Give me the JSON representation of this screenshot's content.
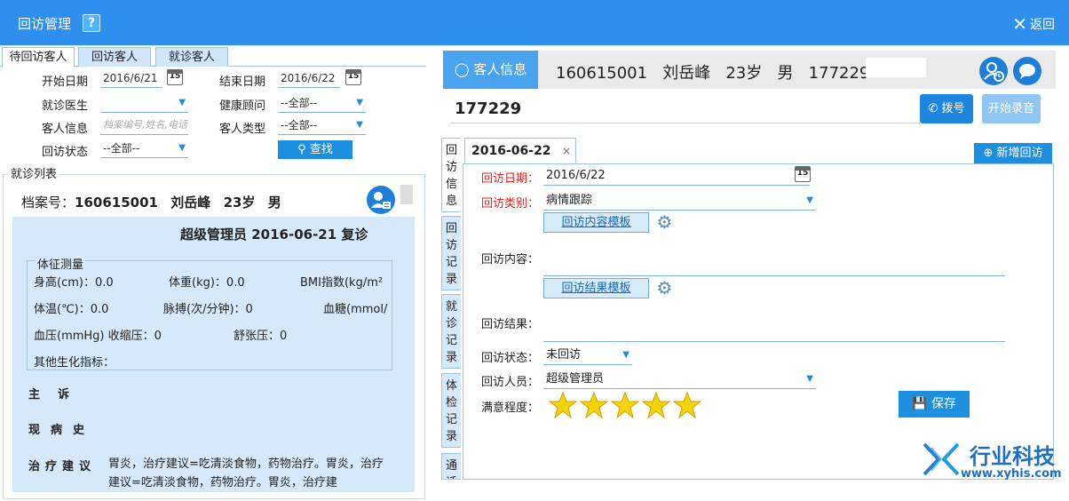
{
  "titlebar": {
    "title": "回访管理",
    "help": "?",
    "back": "返回"
  },
  "left_tabs": [
    "待回访客人",
    "回访客人",
    "就诊客人"
  ],
  "filters": {
    "start_date_label": "开始日期",
    "start_date": "2016/6/21",
    "end_date_label": "结束日期",
    "end_date": "2016/6/22",
    "doctor_label": "就诊医生",
    "doctor": "",
    "consultant_label": "健康顾问",
    "consultant": "--全部--",
    "customer_label": "客人信息",
    "customer_placeholder": "档案编号,姓名,电话",
    "type_label": "客人类型",
    "type": "--全部--",
    "status_label": "回访状态",
    "status": "--全部--",
    "search_button": "查找",
    "calendar_day": "15"
  },
  "visit_list": {
    "title": "就诊列表",
    "record_label": "档案号：",
    "record_id": "160615001",
    "name": "刘岳峰",
    "age": "23岁",
    "gender": "男",
    "visit": "超级管理员  2016-06-21  复诊",
    "vitals_title": "体征测量",
    "height": "身高(cm)：0.0",
    "weight": "体重(kg)：0.0",
    "bmi": "BMI指数(kg/m²",
    "temperature": "体温(℃)：0.0",
    "pulse": "脉搏(次/分钟)：0",
    "glucose": "血糖(mmol/",
    "bp_systolic": "血压(mmHg) 收缩压：0",
    "bp_diastolic": "舒张压：0",
    "other": "其他生化指标：",
    "complaint_label": "主诉",
    "history_label": "现病史",
    "treatment_label": "治疗建议",
    "treatment": "胃炎，治疗建议=吃清淡食物，药物治疗。胃炎，治疗建议=吃清淡食物，药物治疗。胃炎，治疗建"
  },
  "customer": {
    "info_button": "客人信息",
    "id": "160615001",
    "name": "刘岳峰",
    "age": "23岁",
    "gender": "男",
    "phone": "177229",
    "phone_input": "177229",
    "dial_button": "拨号",
    "record_button": "开始录音"
  },
  "vertical_tabs": [
    "回访信息",
    "回访记录",
    "就诊记录",
    "体检记录",
    "通话"
  ],
  "form": {
    "date_tab": "2016-06-22",
    "date_tab_close": "×",
    "add_button": "新增回访",
    "date_label": "回访日期：",
    "date": "2016/6/22",
    "category_label": "回访类别：",
    "category": "病情跟踪",
    "content_template": "回访内容模板",
    "content_label": "回访内容：",
    "result_template": "回访结果模板",
    "result_label": "回访结果：",
    "status_label": "回访状态：",
    "status": "未回访",
    "staff_label": "回访人员：",
    "staff": "超级管理员",
    "satisfaction_label": "满意程度：",
    "satisfaction_stars": 5,
    "save_button": "保存"
  },
  "logo": {
    "name": "行业科技",
    "url": "www.xyhis.com"
  },
  "colors": {
    "titlebar": "#2f8fef",
    "accent": "#1d8fe0",
    "star": "#f5d20a",
    "required": "#e02020"
  }
}
